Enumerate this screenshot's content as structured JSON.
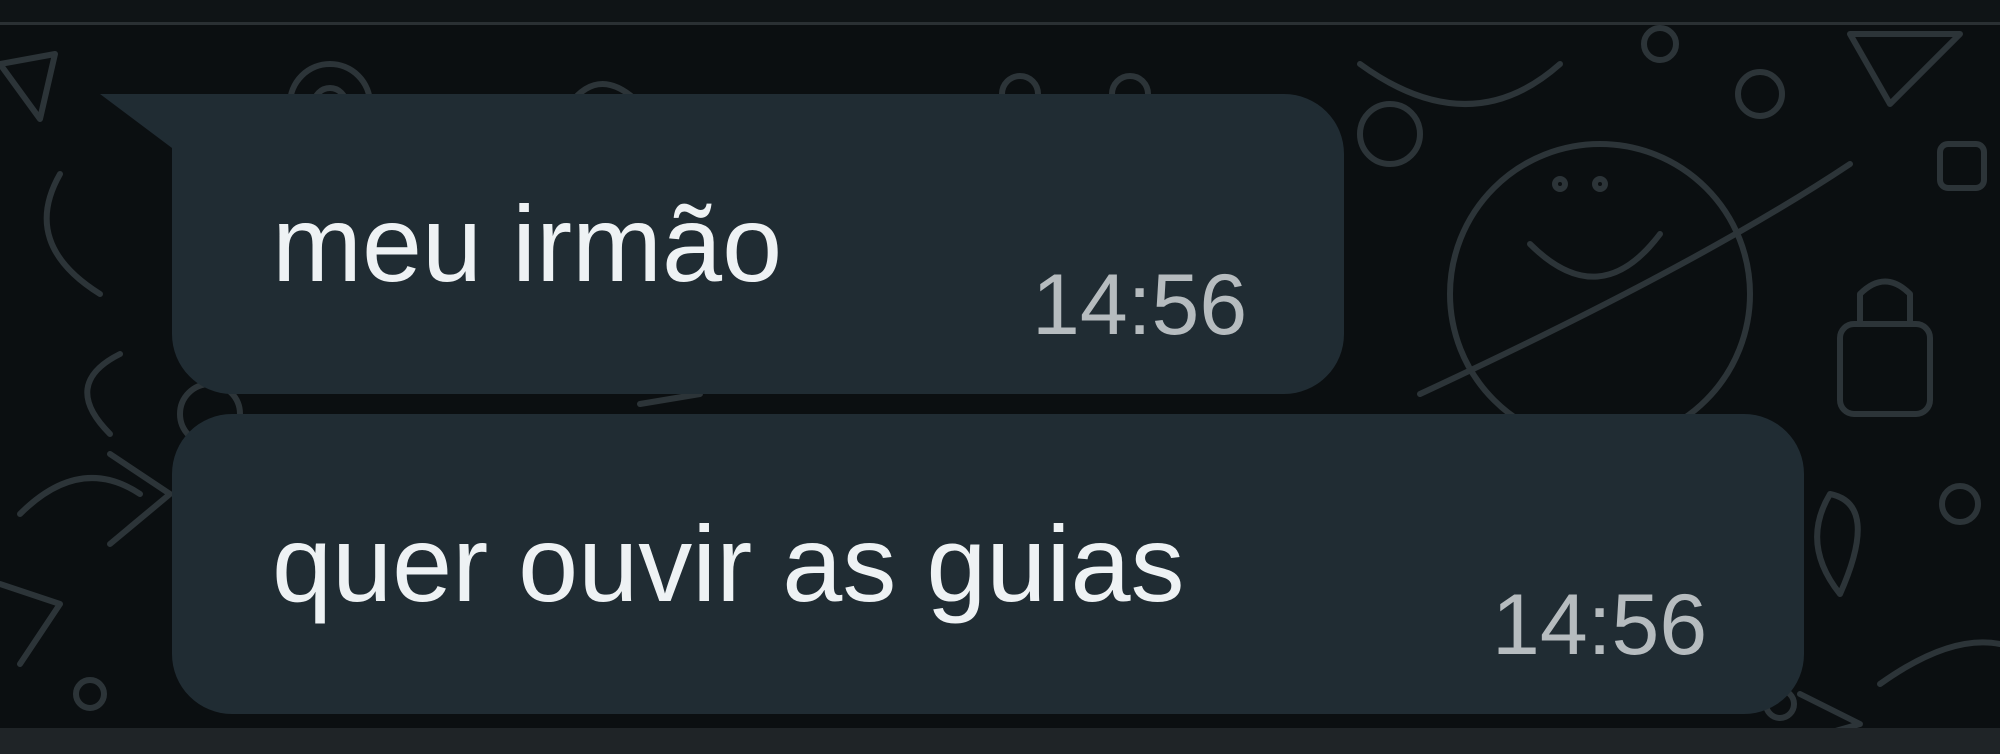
{
  "chat": {
    "messages": [
      {
        "text": "meu irmão",
        "time": "14:56"
      },
      {
        "text": "quer ouvir as guias",
        "time": "14:56"
      }
    ]
  },
  "theme": {
    "background": "#0b0f11",
    "bubble": "#202c33",
    "text": "#eef2f4",
    "time": "#b6bcbf",
    "doodle": "#2c3438"
  }
}
